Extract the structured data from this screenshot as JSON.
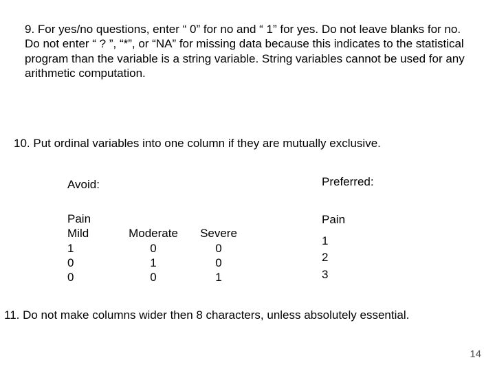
{
  "items": {
    "nine": " 9.  For yes/no questions, enter “ 0” for no and “ 1” for yes.  Do not leave blanks for no.  Do not enter “ ? ”, “*”, or “NA” for missing data because this indicates to the statistical program than the variable is a string variable.  String variables cannot be used for any arithmetic computation.",
    "ten": "10.  Put ordinal variables into one column if they are mutually exclusive.",
    "eleven": "11.  Do not make columns wider then 8 characters, unless absolutely essential."
  },
  "labels": {
    "avoid": "Avoid:",
    "preferred": "Preferred:"
  },
  "avoid_table": {
    "pain": "Pain",
    "headers": {
      "mild": "Mild",
      "moderate": "Moderate",
      "severe": "Severe"
    },
    "rows": [
      {
        "mild": "1",
        "moderate": "0",
        "severe": "0"
      },
      {
        "mild": "0",
        "moderate": "1",
        "severe": "0"
      },
      {
        "mild": "0",
        "moderate": "0",
        "severe": "1"
      }
    ]
  },
  "preferred_block": {
    "pain": "Pain",
    "values": [
      "1",
      "2",
      "3"
    ]
  },
  "page_number": "14",
  "chart_data": {
    "type": "table",
    "title": "Ordinal variable coding example",
    "avoid": {
      "columns": [
        "Mild",
        "Moderate",
        "Severe"
      ],
      "rows": [
        [
          1,
          0,
          0
        ],
        [
          0,
          1,
          0
        ],
        [
          0,
          0,
          1
        ]
      ]
    },
    "preferred": {
      "column": "Pain",
      "rows": [
        1,
        2,
        3
      ]
    }
  }
}
